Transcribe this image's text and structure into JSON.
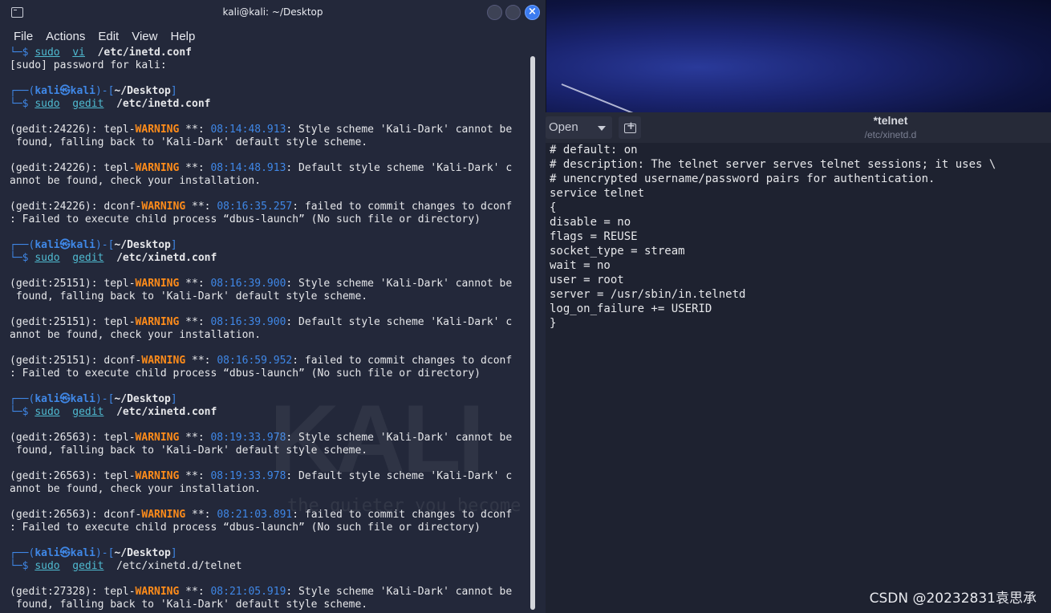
{
  "terminal": {
    "title": "kali@kali: ~/Desktop",
    "menu": [
      "File",
      "Actions",
      "Edit",
      "View",
      "Help"
    ],
    "lines": [
      [
        {
          "t": "└─$ ",
          "c": "c-blue"
        },
        {
          "t": "sudo",
          "c": "c-cmd"
        },
        {
          "t": "  "
        },
        {
          "t": "vi",
          "c": "c-cmd"
        },
        {
          "t": "  "
        },
        {
          "t": "/etc/inetd.conf",
          "c": "c-bold"
        }
      ],
      [
        {
          "t": "[sudo] password for kali:"
        }
      ],
      [
        {
          "t": ""
        }
      ],
      [
        {
          "t": "┌──(",
          "c": "c-blue"
        },
        {
          "t": "kali㉿kali",
          "c": "c-blue c-bold"
        },
        {
          "t": ")-[",
          "c": "c-blue"
        },
        {
          "t": "~/Desktop",
          "c": "c-bold"
        },
        {
          "t": "]",
          "c": "c-blue"
        }
      ],
      [
        {
          "t": "└─$ ",
          "c": "c-blue"
        },
        {
          "t": "sudo",
          "c": "c-cmd"
        },
        {
          "t": "  "
        },
        {
          "t": "gedit",
          "c": "c-cmd"
        },
        {
          "t": "  "
        },
        {
          "t": "/etc/inetd.conf",
          "c": "c-bold"
        }
      ],
      [
        {
          "t": ""
        }
      ],
      [
        {
          "t": "(gedit:24226): tepl-"
        },
        {
          "t": "WARNING",
          "c": "c-warn"
        },
        {
          "t": " **: "
        },
        {
          "t": "08:14:48.913",
          "c": "c-time"
        },
        {
          "t": ": Style scheme 'Kali-Dark' cannot be"
        }
      ],
      [
        {
          "t": " found, falling back to 'Kali-Dark' default style scheme."
        }
      ],
      [
        {
          "t": ""
        }
      ],
      [
        {
          "t": "(gedit:24226): tepl-"
        },
        {
          "t": "WARNING",
          "c": "c-warn"
        },
        {
          "t": " **: "
        },
        {
          "t": "08:14:48.913",
          "c": "c-time"
        },
        {
          "t": ": Default style scheme 'Kali-Dark' c"
        }
      ],
      [
        {
          "t": "annot be found, check your installation."
        }
      ],
      [
        {
          "t": ""
        }
      ],
      [
        {
          "t": "(gedit:24226): dconf-"
        },
        {
          "t": "WARNING",
          "c": "c-warn"
        },
        {
          "t": " **: "
        },
        {
          "t": "08:16:35.257",
          "c": "c-time"
        },
        {
          "t": ": failed to commit changes to dconf"
        }
      ],
      [
        {
          "t": ": Failed to execute child process “dbus-launch” (No such file or directory)"
        }
      ],
      [
        {
          "t": ""
        }
      ],
      [
        {
          "t": "┌──(",
          "c": "c-blue"
        },
        {
          "t": "kali㉿kali",
          "c": "c-blue c-bold"
        },
        {
          "t": ")-[",
          "c": "c-blue"
        },
        {
          "t": "~/Desktop",
          "c": "c-bold"
        },
        {
          "t": "]",
          "c": "c-blue"
        }
      ],
      [
        {
          "t": "└─$ ",
          "c": "c-blue"
        },
        {
          "t": "sudo",
          "c": "c-cmd"
        },
        {
          "t": "  "
        },
        {
          "t": "gedit",
          "c": "c-cmd"
        },
        {
          "t": "  "
        },
        {
          "t": "/etc/xinetd.conf",
          "c": "c-bold"
        }
      ],
      [
        {
          "t": ""
        }
      ],
      [
        {
          "t": "(gedit:25151): tepl-"
        },
        {
          "t": "WARNING",
          "c": "c-warn"
        },
        {
          "t": " **: "
        },
        {
          "t": "08:16:39.900",
          "c": "c-time"
        },
        {
          "t": ": Style scheme 'Kali-Dark' cannot be"
        }
      ],
      [
        {
          "t": " found, falling back to 'Kali-Dark' default style scheme."
        }
      ],
      [
        {
          "t": ""
        }
      ],
      [
        {
          "t": "(gedit:25151): tepl-"
        },
        {
          "t": "WARNING",
          "c": "c-warn"
        },
        {
          "t": " **: "
        },
        {
          "t": "08:16:39.900",
          "c": "c-time"
        },
        {
          "t": ": Default style scheme 'Kali-Dark' c"
        }
      ],
      [
        {
          "t": "annot be found, check your installation."
        }
      ],
      [
        {
          "t": ""
        }
      ],
      [
        {
          "t": "(gedit:25151): dconf-"
        },
        {
          "t": "WARNING",
          "c": "c-warn"
        },
        {
          "t": " **: "
        },
        {
          "t": "08:16:59.952",
          "c": "c-time"
        },
        {
          "t": ": failed to commit changes to dconf"
        }
      ],
      [
        {
          "t": ": Failed to execute child process “dbus-launch” (No such file or directory)"
        }
      ],
      [
        {
          "t": ""
        }
      ],
      [
        {
          "t": "┌──(",
          "c": "c-blue"
        },
        {
          "t": "kali㉿kali",
          "c": "c-blue c-bold"
        },
        {
          "t": ")-[",
          "c": "c-blue"
        },
        {
          "t": "~/Desktop",
          "c": "c-bold"
        },
        {
          "t": "]",
          "c": "c-blue"
        }
      ],
      [
        {
          "t": "└─$ ",
          "c": "c-blue"
        },
        {
          "t": "sudo",
          "c": "c-cmd"
        },
        {
          "t": "  "
        },
        {
          "t": "gedit",
          "c": "c-cmd"
        },
        {
          "t": "  "
        },
        {
          "t": "/etc/xinetd.conf",
          "c": "c-bold"
        }
      ],
      [
        {
          "t": ""
        }
      ],
      [
        {
          "t": "(gedit:26563): tepl-"
        },
        {
          "t": "WARNING",
          "c": "c-warn"
        },
        {
          "t": " **: "
        },
        {
          "t": "08:19:33.978",
          "c": "c-time"
        },
        {
          "t": ": Style scheme 'Kali-Dark' cannot be"
        }
      ],
      [
        {
          "t": " found, falling back to 'Kali-Dark' default style scheme."
        }
      ],
      [
        {
          "t": ""
        }
      ],
      [
        {
          "t": "(gedit:26563): tepl-"
        },
        {
          "t": "WARNING",
          "c": "c-warn"
        },
        {
          "t": " **: "
        },
        {
          "t": "08:19:33.978",
          "c": "c-time"
        },
        {
          "t": ": Default style scheme 'Kali-Dark' c"
        }
      ],
      [
        {
          "t": "annot be found, check your installation."
        }
      ],
      [
        {
          "t": ""
        }
      ],
      [
        {
          "t": "(gedit:26563): dconf-"
        },
        {
          "t": "WARNING",
          "c": "c-warn"
        },
        {
          "t": " **: "
        },
        {
          "t": "08:21:03.891",
          "c": "c-time"
        },
        {
          "t": ": failed to commit changes to dconf"
        }
      ],
      [
        {
          "t": ": Failed to execute child process “dbus-launch” (No such file or directory)"
        }
      ],
      [
        {
          "t": ""
        }
      ],
      [
        {
          "t": "┌──(",
          "c": "c-blue"
        },
        {
          "t": "kali㉿kali",
          "c": "c-blue c-bold"
        },
        {
          "t": ")-[",
          "c": "c-blue"
        },
        {
          "t": "~/Desktop",
          "c": "c-bold"
        },
        {
          "t": "]",
          "c": "c-blue"
        }
      ],
      [
        {
          "t": "└─$ ",
          "c": "c-blue"
        },
        {
          "t": "sudo",
          "c": "c-cmd"
        },
        {
          "t": "  "
        },
        {
          "t": "gedit",
          "c": "c-cmd"
        },
        {
          "t": "  "
        },
        {
          "t": "/etc/xinetd.d/telnet"
        }
      ],
      [
        {
          "t": ""
        }
      ],
      [
        {
          "t": "(gedit:27328): tepl-"
        },
        {
          "t": "WARNING",
          "c": "c-warn"
        },
        {
          "t": " **: "
        },
        {
          "t": "08:21:05.919",
          "c": "c-time"
        },
        {
          "t": ": Style scheme 'Kali-Dark' cannot be"
        }
      ],
      [
        {
          "t": " found, falling back to 'Kali-Dark' default style scheme."
        }
      ]
    ],
    "watermark": "KALI",
    "watermark_tagline": "the quieter you become"
  },
  "gedit": {
    "open_label": "Open",
    "title": "*telnet",
    "subtitle": "/etc/xinetd.d",
    "lines": [
      "# default: on",
      "# description: The telnet server serves telnet sessions; it uses \\",
      "# unencrypted username/password pairs for authentication.",
      "service telnet",
      "{",
      "disable = no",
      "flags = REUSE",
      "socket_type = stream",
      "wait = no",
      "user = root",
      "server = /usr/sbin/in.telnetd",
      "log_on_failure += USERID",
      "}"
    ]
  },
  "watermark_credit": "CSDN @20232831袁思承",
  "colors": {
    "accent": "#3f87e6",
    "warning": "#ff8c1a",
    "terminal_bg": "#23283a"
  }
}
